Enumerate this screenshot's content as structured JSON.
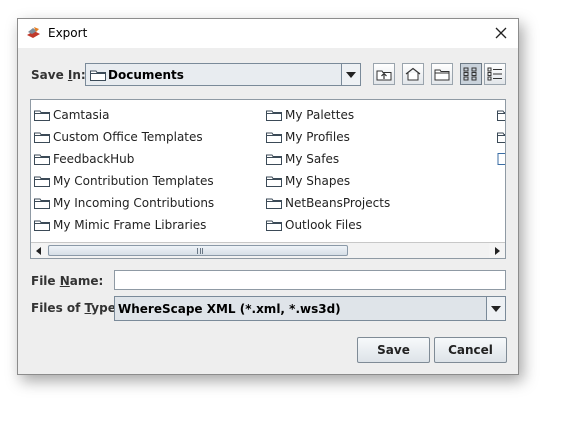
{
  "window": {
    "title": "Export"
  },
  "save_in": {
    "label_pre": "Save ",
    "label_mnemonic": "I",
    "label_post": "n:",
    "value": "Documents"
  },
  "toolbar": {
    "icons": [
      "up-one-level-icon",
      "home-icon",
      "new-folder-icon",
      "list-view-icon",
      "details-view-icon"
    ]
  },
  "files": {
    "column1": [
      "Camtasia",
      "Custom Office Templates",
      "FeedbackHub",
      "My Contribution Templates",
      "My Incoming Contributions",
      "My Mimic Frame Libraries"
    ],
    "column2": [
      "My Palettes",
      "My Profiles",
      "My Safes",
      "My Shapes",
      "NetBeansProjects",
      "Outlook Files"
    ]
  },
  "file_name": {
    "label_pre": "File ",
    "label_mnemonic": "N",
    "label_post": "ame:",
    "value": ""
  },
  "file_type": {
    "label_pre": "Files of ",
    "label_mnemonic": "T",
    "label_post": "ype:",
    "value": "WhereScape XML (*.xml, *.ws3d)"
  },
  "buttons": {
    "save": "Save",
    "cancel": "Cancel"
  }
}
